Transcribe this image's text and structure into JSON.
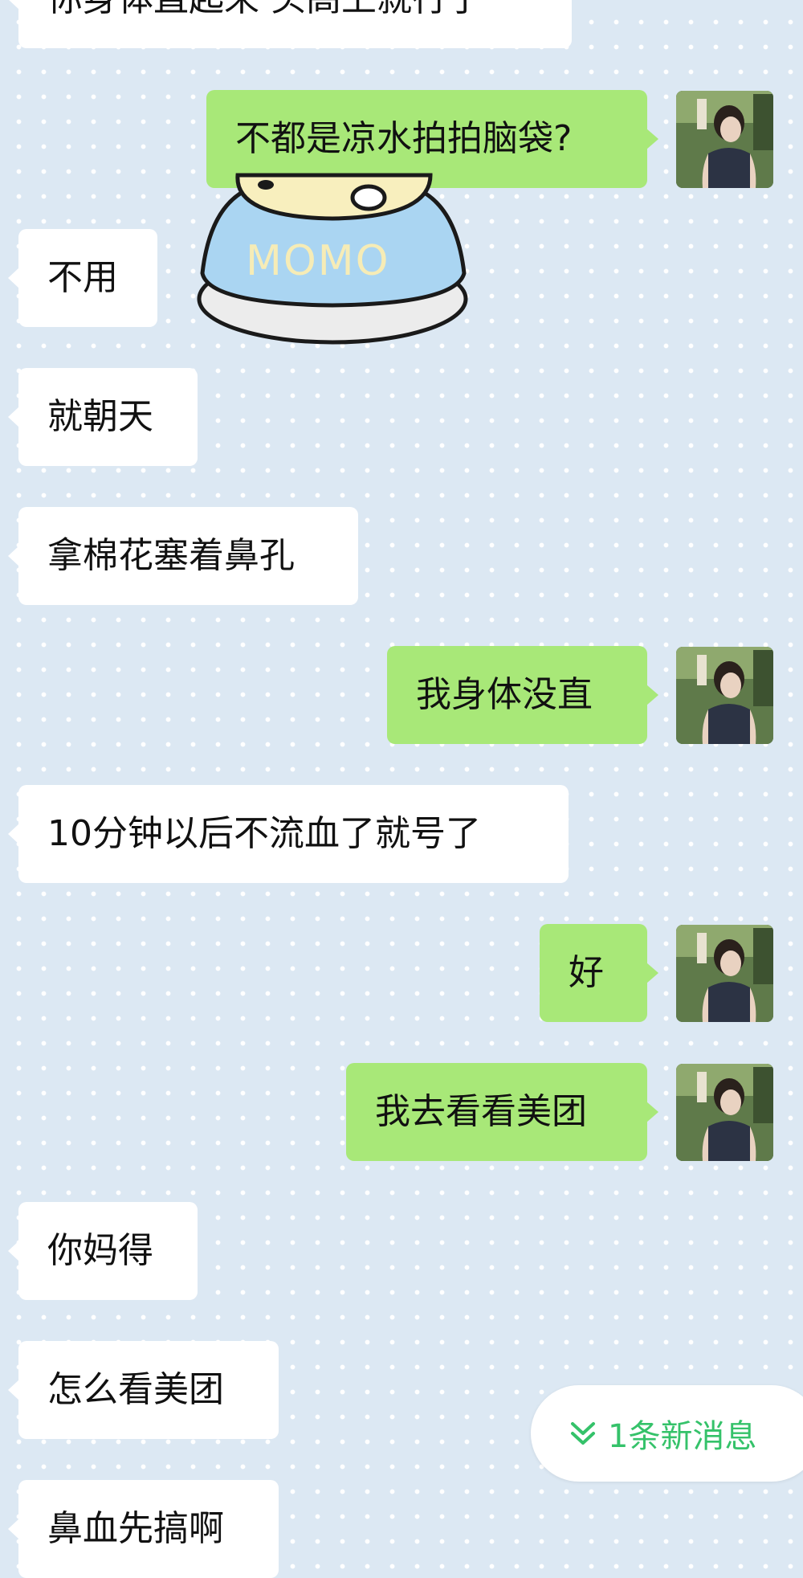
{
  "chat": {
    "messages": [
      {
        "side": "in",
        "text": "你身体直起来 头高上就行了"
      },
      {
        "side": "out",
        "text": "不都是凉水拍拍脑袋?"
      },
      {
        "side": "in",
        "text": "不用"
      },
      {
        "side": "in",
        "text": "就朝天"
      },
      {
        "side": "in",
        "text": "拿棉花塞着鼻孔"
      },
      {
        "side": "out",
        "text": "我身体没直"
      },
      {
        "side": "in",
        "text": "10分钟以后不流血了就号了"
      },
      {
        "side": "out",
        "text": "好"
      },
      {
        "side": "out",
        "text": "我去看看美团"
      },
      {
        "side": "in",
        "text": "你妈得"
      },
      {
        "side": "in",
        "text": "怎么看美团"
      },
      {
        "side": "in",
        "text": "鼻血先搞啊"
      }
    ],
    "sticker": {
      "label": "MOMO"
    }
  },
  "new_message_pill": {
    "label": "1条新消息",
    "icon": "double-chevron-down-icon"
  },
  "colors": {
    "background": "#dce8f3",
    "incoming_bubble": "#ffffff",
    "outgoing_bubble": "#a8e878",
    "new_message_text": "#35c26a"
  }
}
